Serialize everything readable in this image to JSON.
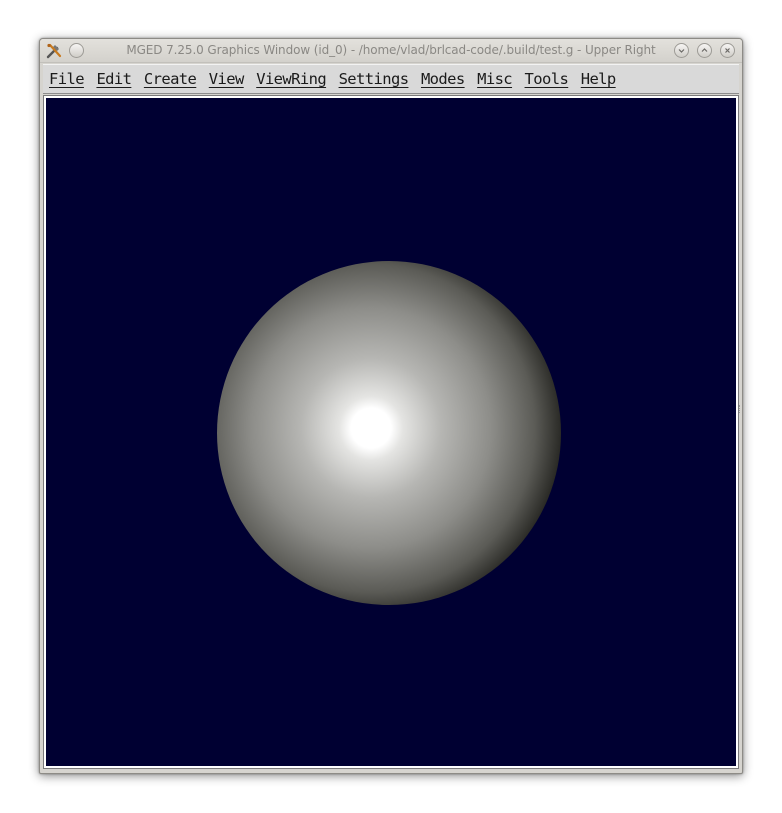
{
  "window": {
    "title": "MGED 7.25.0 Graphics Window (id_0) - /home/vlad/brlcad-code/.build/test.g - Upper Right"
  },
  "menubar": {
    "items": [
      {
        "label": "File"
      },
      {
        "label": "Edit"
      },
      {
        "label": "Create"
      },
      {
        "label": "View"
      },
      {
        "label": "ViewRing"
      },
      {
        "label": "Settings"
      },
      {
        "label": "Modes"
      },
      {
        "label": "Misc"
      },
      {
        "label": "Tools"
      },
      {
        "label": "Help"
      }
    ]
  },
  "canvas": {
    "background_color": "#000032",
    "object": "shaded-sphere",
    "highlight_color": "#ffffff",
    "shadow_color": "#1a1a14"
  },
  "icons": {
    "app": "tools-icon",
    "window_menu": "window-menu-icon",
    "minimize": "minimize-icon",
    "maximize": "maximize-icon",
    "close": "close-icon"
  }
}
